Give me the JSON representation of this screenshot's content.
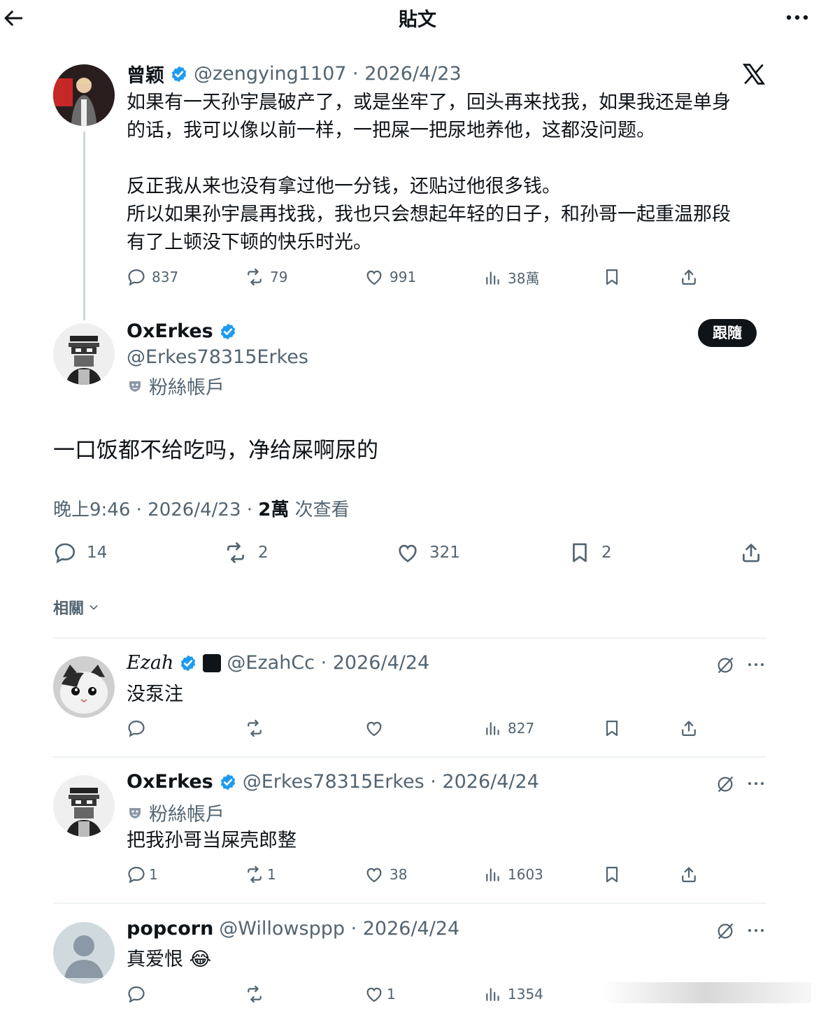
{
  "header": {
    "title": "貼文"
  },
  "parent_tweet": {
    "name": "曾颖",
    "handle_date": "@zengying1107 · 2026/4/23",
    "text_p1": "如果有一天孙宇晨破产了，或是坐牢了，回头再来找我，如果我还是单身",
    "text_p2": "的话，我可以像以前一样，一把屎一把尿地养他，这都没问题。",
    "text_p3": "反正我从来也没有拿过他一分钱，还贴过他很多钱。",
    "text_p4": "所以如果孙宇晨再找我，我也只会想起年轻的日子，和孙哥一起重温那段",
    "text_p5": "有了上顿没下顿的快乐时光。",
    "replies": "837",
    "retweets": "79",
    "likes": "991",
    "views": "38萬"
  },
  "main_tweet": {
    "name": "OxErkes",
    "handle": "@Erkes78315Erkes",
    "fan_label": "粉絲帳戶",
    "follow_label": "跟隨",
    "text": "一口饭都不给吃吗，净给屎啊尿的",
    "time": "晚上9:46 · 2026/4/23 · ",
    "views_bold": "2萬",
    "views_suffix": " 次查看",
    "replies": "14",
    "retweets": "2",
    "likes": "321",
    "bookmarks": "2"
  },
  "related_label": "相關",
  "replies": [
    {
      "name": "Ezah",
      "handle_date": "@EzahCc · 2026/4/24",
      "text": "没泵注",
      "views": "827"
    },
    {
      "name": "OxErkes",
      "handle_date": "@Erkes78315Erkes · 2026/4/24",
      "fan_label": "粉絲帳戶",
      "text": "把我孙哥当屎壳郎整",
      "replies": "1",
      "retweets": "1",
      "likes": "38",
      "views": "1603"
    },
    {
      "name": "popcorn",
      "handle_date": "@Willowsppp · 2026/4/24",
      "text": "真爱恨 😂",
      "likes": "1",
      "views": "1354"
    }
  ],
  "colors": {
    "verified": "#1d9bf0",
    "text": "#0f1419",
    "secondary": "#536471",
    "divider": "#eff3f4"
  }
}
